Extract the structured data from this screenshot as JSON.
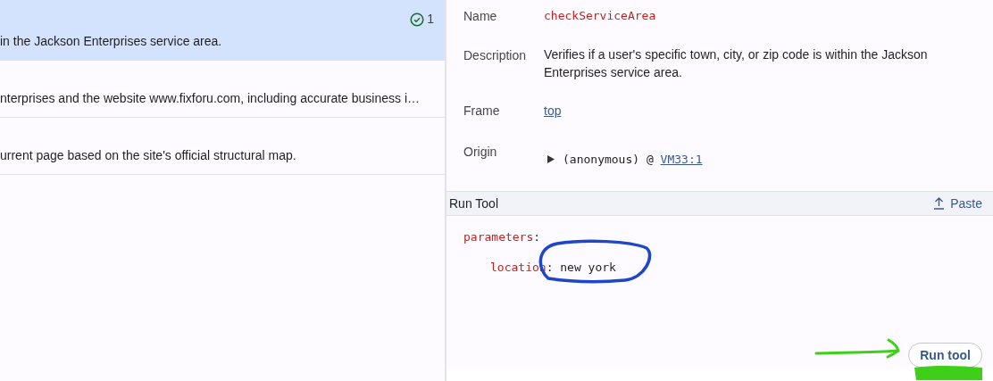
{
  "tool_list": [
    {
      "text": "in the Jackson Enterprises service area.",
      "selected": true,
      "badge": "1"
    },
    {
      "text": "nterprises and the website www.fixforu.com, including accurate business i…",
      "selected": false
    },
    {
      "text": "urrent page based on the site's official structural map.",
      "selected": false
    }
  ],
  "details": {
    "name_label": "Name",
    "name_value": "checkServiceArea",
    "description_label": "Description",
    "description_value": "Verifies if a user's specific town, city, or zip code is within the Jackson Enterprises service area.",
    "frame_label": "Frame",
    "frame_value": "top",
    "origin_label": "Origin",
    "origin_function": "(anonymous) @ ",
    "origin_link": "VM33:1"
  },
  "run_tool": {
    "title": "Run Tool",
    "paste_button": "Paste",
    "parameters_key": "parameters",
    "colon": ":",
    "param_key": "location",
    "param_value": ": new york",
    "run_button": "Run tool"
  }
}
